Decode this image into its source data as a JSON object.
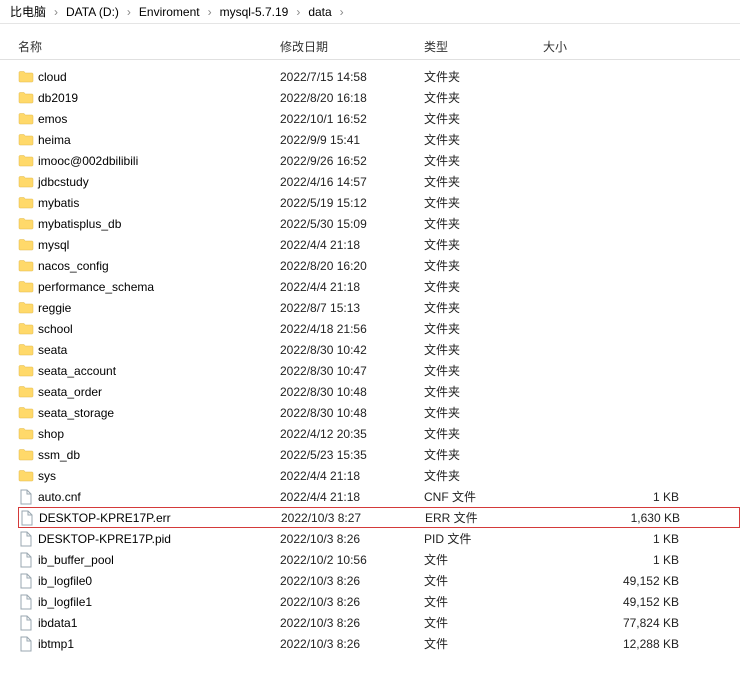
{
  "breadcrumb": {
    "items": [
      {
        "label": "比电脑"
      },
      {
        "label": "DATA (D:)"
      },
      {
        "label": "Enviroment"
      },
      {
        "label": "mysql-5.7.19"
      },
      {
        "label": "data"
      }
    ]
  },
  "columns": {
    "name": "名称",
    "date": "修改日期",
    "type": "类型",
    "size": "大小"
  },
  "rows": [
    {
      "kind": "folder",
      "name": "cloud",
      "date": "2022/7/15 14:58",
      "type": "文件夹",
      "size": ""
    },
    {
      "kind": "folder",
      "name": "db2019",
      "date": "2022/8/20 16:18",
      "type": "文件夹",
      "size": ""
    },
    {
      "kind": "folder",
      "name": "emos",
      "date": "2022/10/1 16:52",
      "type": "文件夹",
      "size": ""
    },
    {
      "kind": "folder",
      "name": "heima",
      "date": "2022/9/9 15:41",
      "type": "文件夹",
      "size": ""
    },
    {
      "kind": "folder",
      "name": "imooc@002dbilibili",
      "date": "2022/9/26 16:52",
      "type": "文件夹",
      "size": ""
    },
    {
      "kind": "folder",
      "name": "jdbcstudy",
      "date": "2022/4/16 14:57",
      "type": "文件夹",
      "size": ""
    },
    {
      "kind": "folder",
      "name": "mybatis",
      "date": "2022/5/19 15:12",
      "type": "文件夹",
      "size": ""
    },
    {
      "kind": "folder",
      "name": "mybatisplus_db",
      "date": "2022/5/30 15:09",
      "type": "文件夹",
      "size": ""
    },
    {
      "kind": "folder",
      "name": "mysql",
      "date": "2022/4/4 21:18",
      "type": "文件夹",
      "size": ""
    },
    {
      "kind": "folder",
      "name": "nacos_config",
      "date": "2022/8/20 16:20",
      "type": "文件夹",
      "size": ""
    },
    {
      "kind": "folder",
      "name": "performance_schema",
      "date": "2022/4/4 21:18",
      "type": "文件夹",
      "size": ""
    },
    {
      "kind": "folder",
      "name": "reggie",
      "date": "2022/8/7 15:13",
      "type": "文件夹",
      "size": ""
    },
    {
      "kind": "folder",
      "name": "school",
      "date": "2022/4/18 21:56",
      "type": "文件夹",
      "size": ""
    },
    {
      "kind": "folder",
      "name": "seata",
      "date": "2022/8/30 10:42",
      "type": "文件夹",
      "size": ""
    },
    {
      "kind": "folder",
      "name": "seata_account",
      "date": "2022/8/30 10:47",
      "type": "文件夹",
      "size": ""
    },
    {
      "kind": "folder",
      "name": "seata_order",
      "date": "2022/8/30 10:48",
      "type": "文件夹",
      "size": ""
    },
    {
      "kind": "folder",
      "name": "seata_storage",
      "date": "2022/8/30 10:48",
      "type": "文件夹",
      "size": ""
    },
    {
      "kind": "folder",
      "name": "shop",
      "date": "2022/4/12 20:35",
      "type": "文件夹",
      "size": ""
    },
    {
      "kind": "folder",
      "name": "ssm_db",
      "date": "2022/5/23 15:35",
      "type": "文件夹",
      "size": ""
    },
    {
      "kind": "folder",
      "name": "sys",
      "date": "2022/4/4 21:18",
      "type": "文件夹",
      "size": ""
    },
    {
      "kind": "file",
      "name": "auto.cnf",
      "date": "2022/4/4 21:18",
      "type": "CNF 文件",
      "size": "1 KB"
    },
    {
      "kind": "file",
      "name": "DESKTOP-KPRE17P.err",
      "date": "2022/10/3 8:27",
      "type": "ERR 文件",
      "size": "1,630 KB",
      "highlight": true
    },
    {
      "kind": "file",
      "name": "DESKTOP-KPRE17P.pid",
      "date": "2022/10/3 8:26",
      "type": "PID 文件",
      "size": "1 KB"
    },
    {
      "kind": "file",
      "name": "ib_buffer_pool",
      "date": "2022/10/2 10:56",
      "type": "文件",
      "size": "1 KB"
    },
    {
      "kind": "file",
      "name": "ib_logfile0",
      "date": "2022/10/3 8:26",
      "type": "文件",
      "size": "49,152 KB"
    },
    {
      "kind": "file",
      "name": "ib_logfile1",
      "date": "2022/10/3 8:26",
      "type": "文件",
      "size": "49,152 KB"
    },
    {
      "kind": "file",
      "name": "ibdata1",
      "date": "2022/10/3 8:26",
      "type": "文件",
      "size": "77,824 KB"
    },
    {
      "kind": "file",
      "name": "ibtmp1",
      "date": "2022/10/3 8:26",
      "type": "文件",
      "size": "12,288 KB"
    }
  ]
}
